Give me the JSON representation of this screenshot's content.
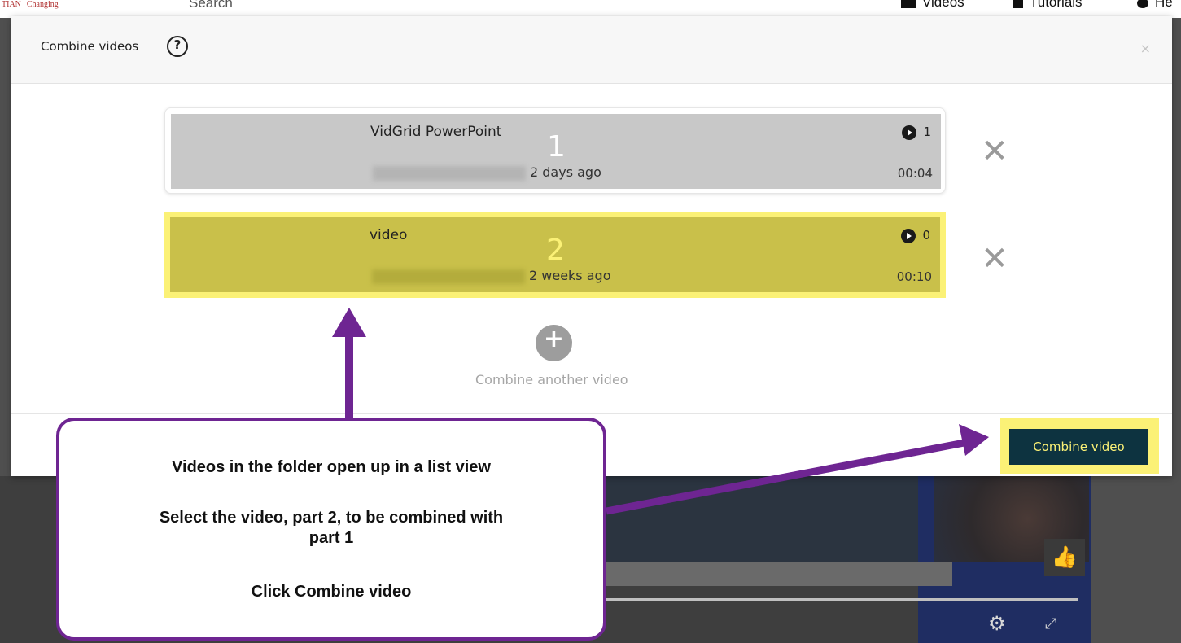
{
  "app": {
    "logo_text": "TIAN | Changing",
    "search_placeholder": "Search",
    "nav": {
      "videos": "Videos",
      "tutorials": "Tutorials",
      "help": "He"
    }
  },
  "modal": {
    "title": "Combine videos",
    "help_symbol": "?",
    "close_symbol": "×",
    "videos": [
      {
        "order": "1",
        "title": "VidGrid PowerPoint",
        "date": "2 days ago",
        "views": "1",
        "duration": "00:04",
        "highlighted": false
      },
      {
        "order": "2",
        "title": "video",
        "date": "2 weeks ago",
        "views": "0",
        "duration": "00:10",
        "highlighted": true
      }
    ],
    "remove_symbol": "✕",
    "add_symbol": "+",
    "add_label": "Combine another video",
    "combine_button": "Combine video"
  },
  "callout": {
    "line1": "Videos in the folder open up in a list view",
    "line2": "Select the video, part 2, to be combined with",
    "line3": "part 1",
    "line4": "Click Combine video"
  },
  "colors": {
    "highlight": "#fbf176",
    "callout_border": "#6e2592",
    "button": "#0d3340"
  }
}
